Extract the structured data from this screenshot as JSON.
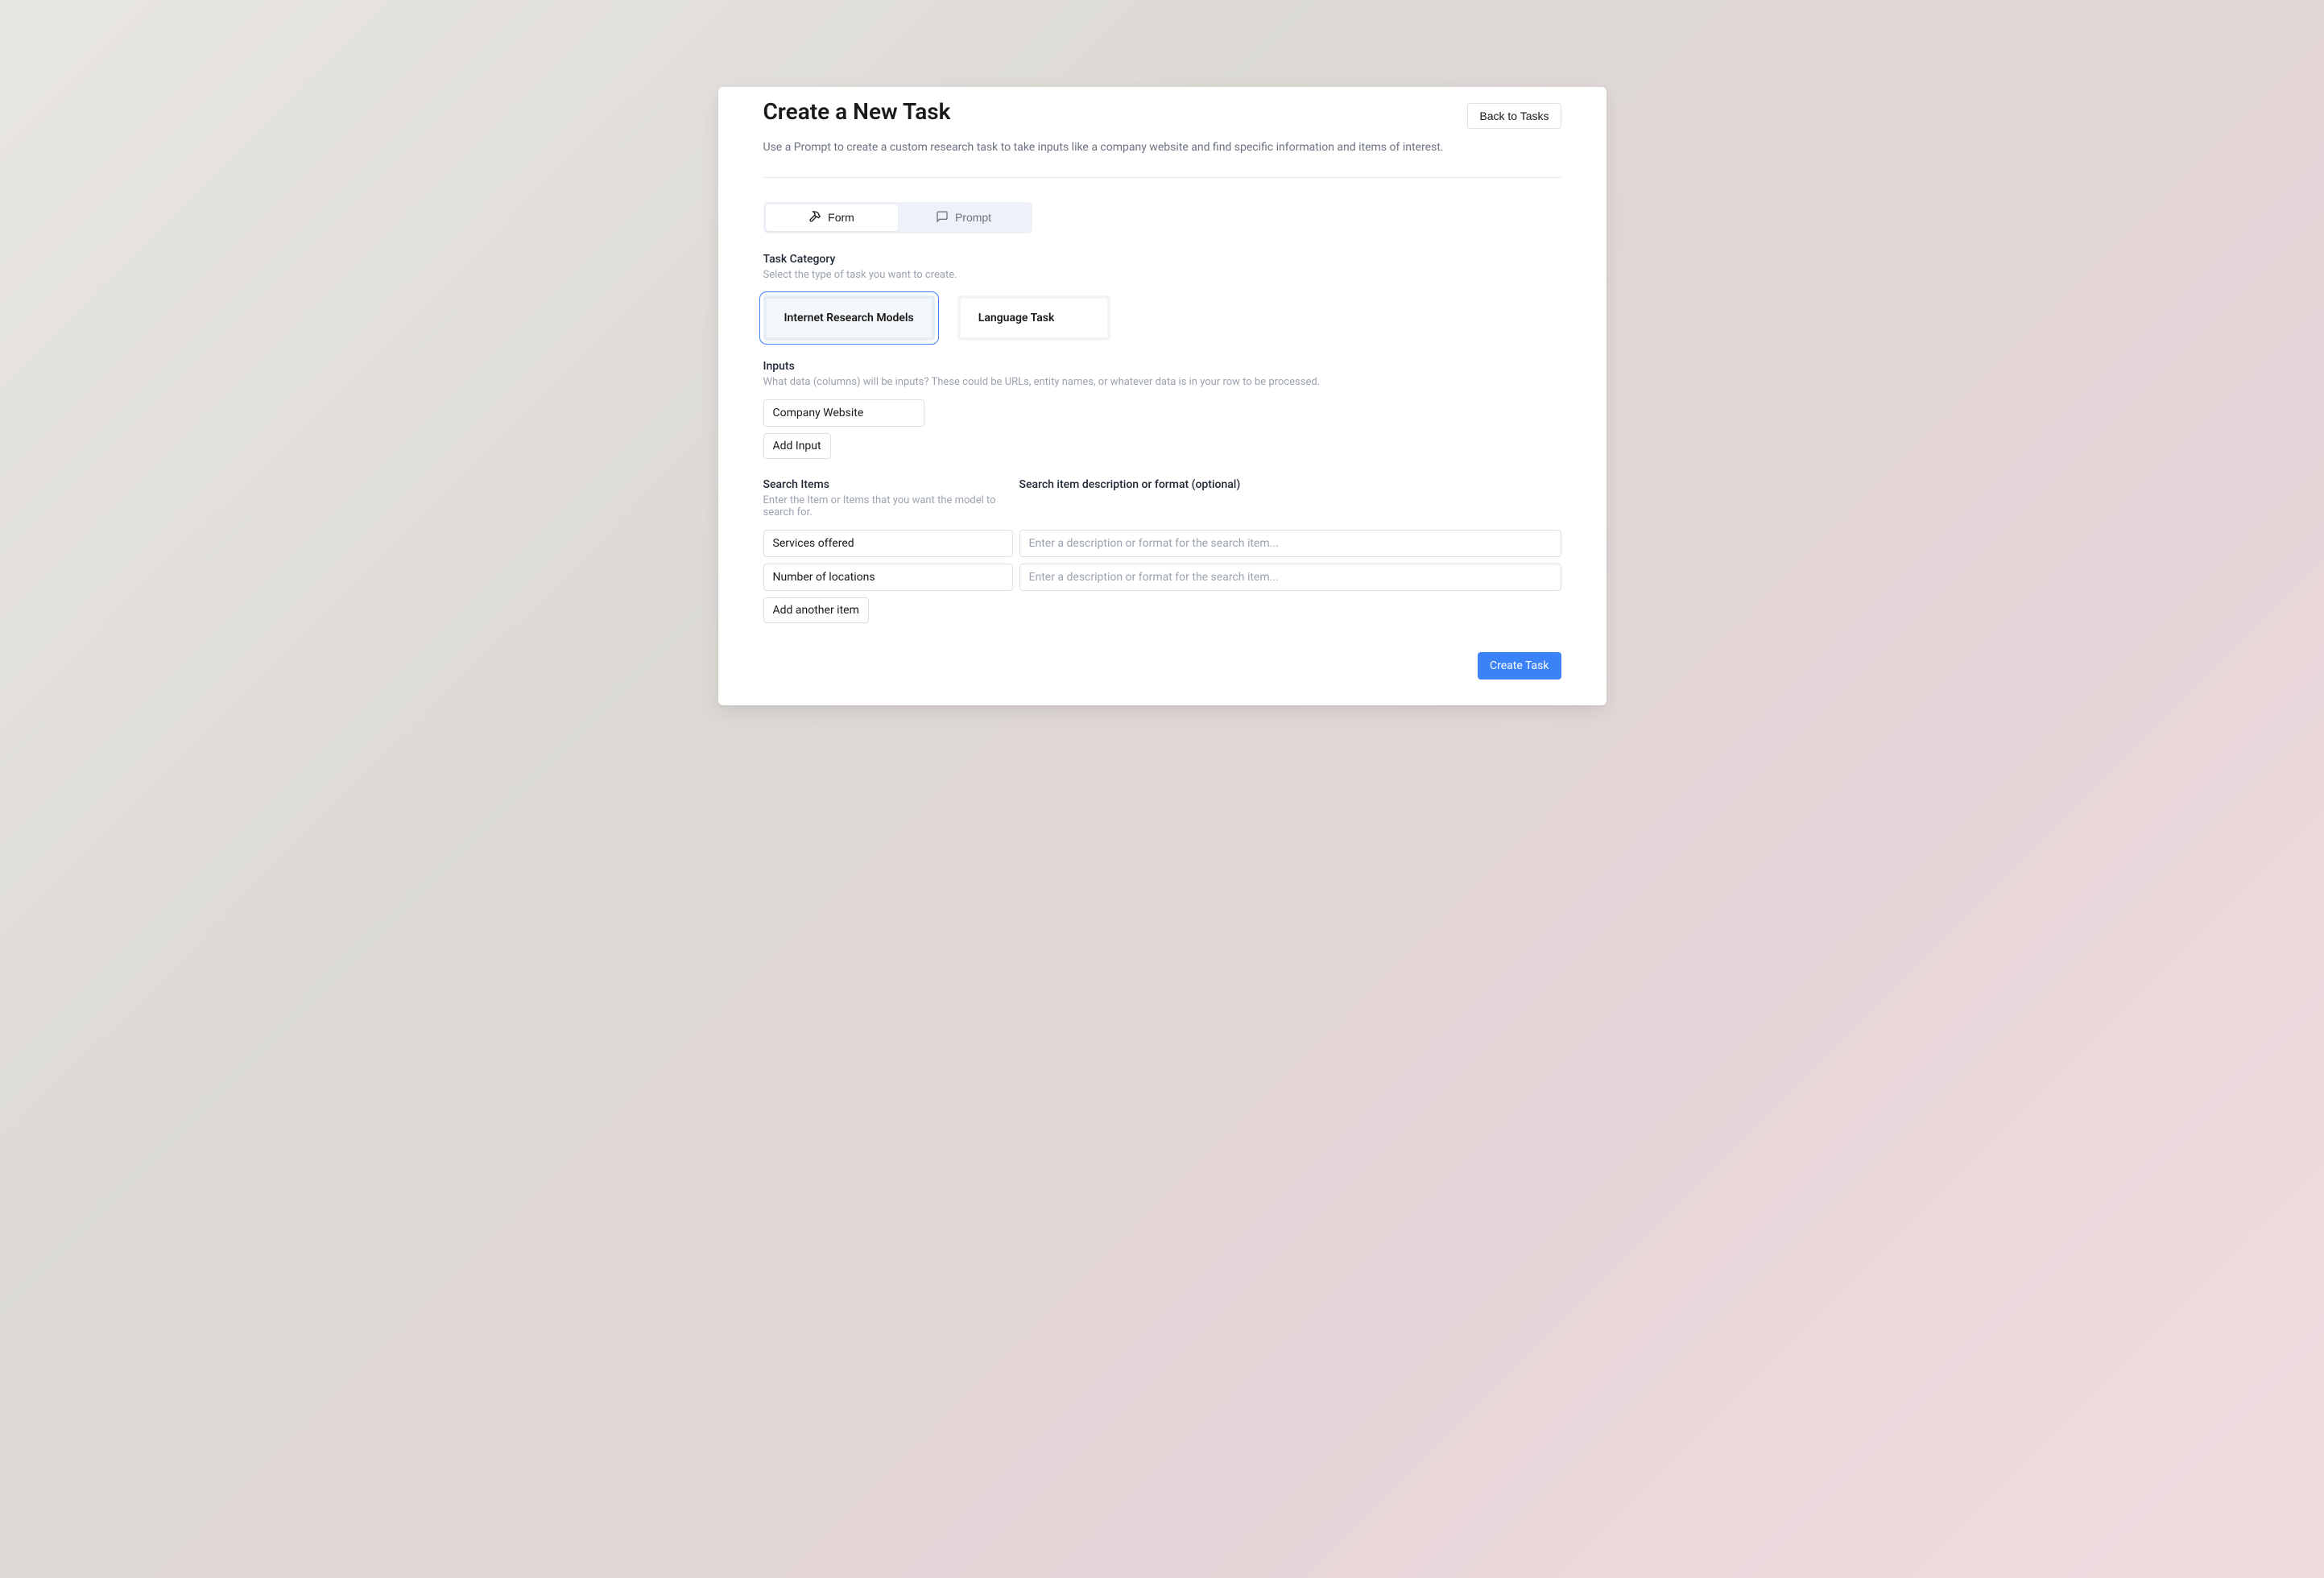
{
  "header": {
    "title": "Create a New Task",
    "back_label": "Back to Tasks",
    "description": "Use a Prompt to create a custom research task to take inputs like a company website and find specific information and items of interest."
  },
  "tabs": {
    "form": "Form",
    "prompt": "Prompt",
    "active": "form"
  },
  "category": {
    "label": "Task Category",
    "hint": "Select the type of task you want to create.",
    "options": [
      {
        "id": "internet",
        "label": "Internet Research Models",
        "selected": true
      },
      {
        "id": "language",
        "label": "Language Task",
        "selected": false
      }
    ]
  },
  "inputs": {
    "label": "Inputs",
    "hint": "What data (columns) will be inputs? These could be URLs, entity names, or whatever data is in your row to be processed.",
    "items": [
      {
        "value": "Company Website"
      }
    ],
    "add_label": "Add Input"
  },
  "search": {
    "items_label": "Search Items",
    "desc_label": "Search item description or format (optional)",
    "items_hint": "Enter the Item or Items that you want the model to search for.",
    "rows": [
      {
        "item": "Services offered",
        "desc": ""
      },
      {
        "item": "Number of locations",
        "desc": ""
      }
    ],
    "desc_placeholder": "Enter a description or format for the search item...",
    "add_label": "Add another item"
  },
  "footer": {
    "create_label": "Create Task"
  }
}
